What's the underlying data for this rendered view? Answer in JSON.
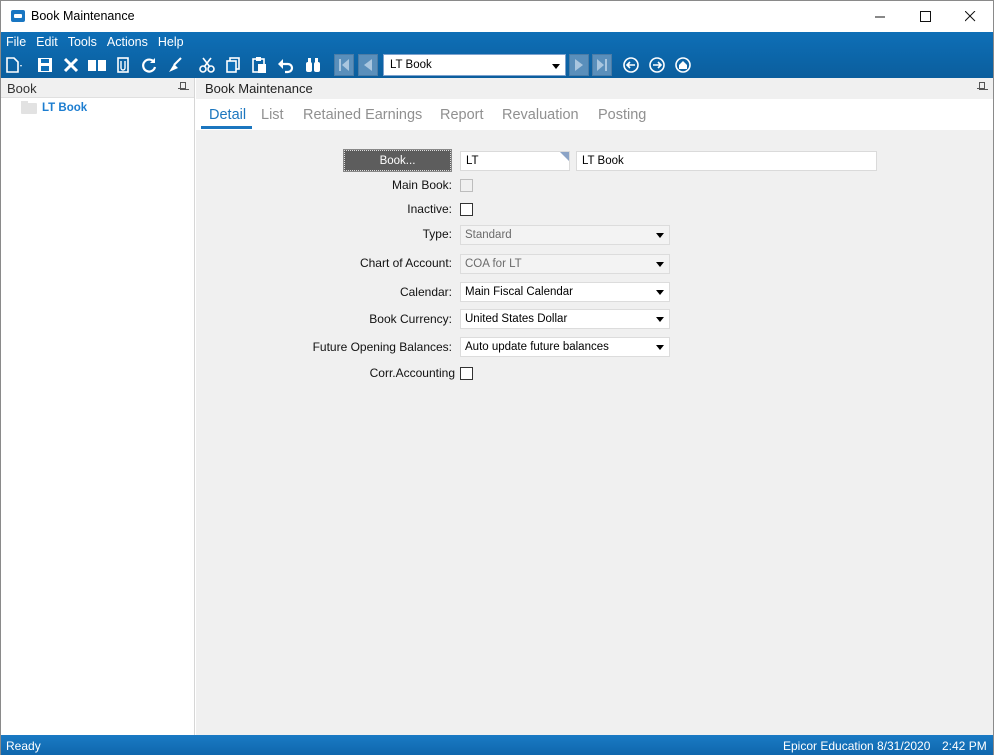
{
  "window": {
    "title": "Book Maintenance"
  },
  "menu": [
    "File",
    "Edit",
    "Tools",
    "Actions",
    "Help"
  ],
  "toolbar": {
    "icons": [
      "new-icon",
      "save-icon",
      "delete-icon",
      "book-icon",
      "attachment-icon",
      "refresh-icon",
      "clear-icon",
      "cut-icon",
      "copy-icon",
      "paste-icon",
      "undo-icon",
      "search-icon",
      "first-icon",
      "prev-icon",
      "next-icon",
      "last-icon",
      "back-icon",
      "forward-icon",
      "home-icon"
    ],
    "nav_value": "LT Book"
  },
  "left_pane": {
    "title": "Book",
    "tree": [
      {
        "label": "LT Book"
      }
    ]
  },
  "right_pane": {
    "title": "Book Maintenance",
    "tabs": [
      "Detail",
      "List",
      "Retained Earnings",
      "Report",
      "Revaluation",
      "Posting"
    ],
    "active_tab": "Detail"
  },
  "form": {
    "book_button": "Book...",
    "book_id": "LT",
    "book_desc": "LT Book",
    "main_book_label": "Main Book:",
    "main_book_checked": false,
    "inactive_label": "Inactive:",
    "inactive_checked": false,
    "type_label": "Type:",
    "type_value": "Standard",
    "coa_label": "Chart of Account:",
    "coa_value": "COA for LT",
    "calendar_label": "Calendar:",
    "calendar_value": "Main Fiscal Calendar",
    "currency_label": "Book Currency:",
    "currency_value": "United States Dollar",
    "future_label": "Future Opening Balances:",
    "future_value": "Auto update future balances",
    "corr_label": "Corr.Accounting",
    "corr_checked": false
  },
  "status": {
    "left": "Ready",
    "company": "Epicor Education",
    "date": "8/31/2020",
    "time": "2:42 PM"
  },
  "colors": {
    "accent": "#0e6fb7",
    "tab_active": "#1b76bf",
    "tree_link": "#1c7dd0"
  }
}
